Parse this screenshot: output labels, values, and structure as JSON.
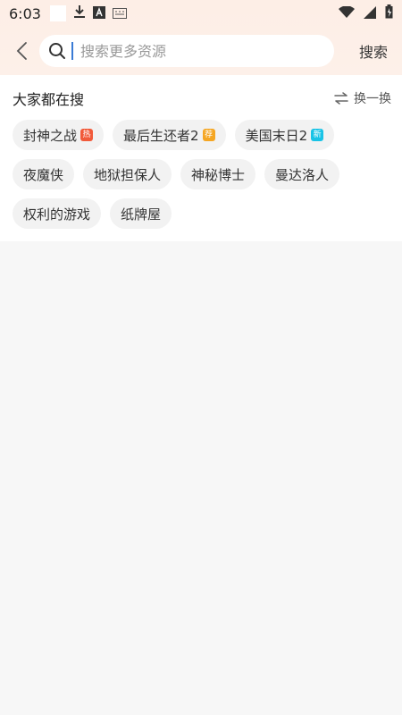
{
  "status": {
    "time": "6:03"
  },
  "search": {
    "placeholder": "搜索更多资源",
    "button_label": "搜索"
  },
  "hot": {
    "title": "大家都在搜",
    "refresh_label": "换一换",
    "tags": [
      {
        "label": "封神之战",
        "badge": "热",
        "badge_color": "#f15a3a"
      },
      {
        "label": "最后生还者2",
        "badge": "荐",
        "badge_color": "#f5a623"
      },
      {
        "label": "美国末日2",
        "badge": "新",
        "badge_color": "#19c3e6"
      },
      {
        "label": "夜魔侠"
      },
      {
        "label": "地狱担保人"
      },
      {
        "label": "神秘博士"
      },
      {
        "label": "曼达洛人"
      },
      {
        "label": "权利的游戏"
      },
      {
        "label": "纸牌屋"
      }
    ]
  }
}
